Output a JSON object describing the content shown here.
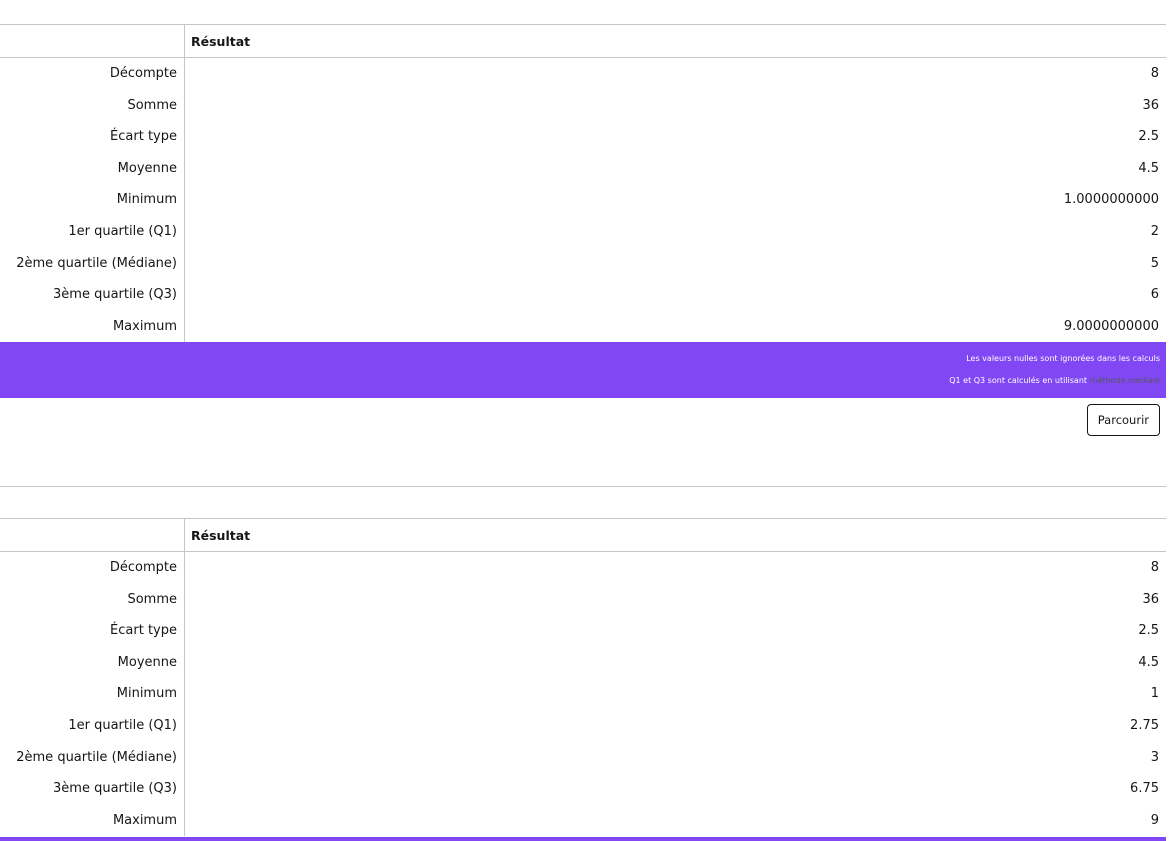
{
  "tables": [
    {
      "header": "Résultat",
      "rows": [
        {
          "label": "Décompte",
          "value": "8"
        },
        {
          "label": "Somme",
          "value": "36"
        },
        {
          "label": "Écart type",
          "value": "2.5"
        },
        {
          "label": "Moyenne",
          "value": "4.5"
        },
        {
          "label": "Minimum",
          "value": "1.0000000000"
        },
        {
          "label": "1er quartile (Q1)",
          "value": "2"
        },
        {
          "label": "2ème quartile (Médiane)",
          "value": "5"
        },
        {
          "label": "3ème quartile (Q3)",
          "value": "6"
        },
        {
          "label": "Maximum",
          "value": "9.0000000000"
        }
      ],
      "footer": {
        "note_nulls": "Les valeurs nulles sont ignorées dans les calculs",
        "note_quartiles_prefix": "Q1 et Q3 sont calculés en utilisant",
        "note_quartiles_link": "méthode médiale"
      },
      "browse_label": "Parcourir"
    },
    {
      "header": "Résultat",
      "rows": [
        {
          "label": "Décompte",
          "value": "8"
        },
        {
          "label": "Somme",
          "value": "36"
        },
        {
          "label": "Écart type",
          "value": "2.5"
        },
        {
          "label": "Moyenne",
          "value": "4.5"
        },
        {
          "label": "Minimum",
          "value": "1"
        },
        {
          "label": "1er quartile (Q1)",
          "value": "2.75"
        },
        {
          "label": "2ème quartile (Médiane)",
          "value": "3"
        },
        {
          "label": "3ème quartile (Q3)",
          "value": "6.75"
        },
        {
          "label": "Maximum",
          "value": "9"
        }
      ]
    }
  ],
  "colors": {
    "accent": "#8247f5",
    "border": "#c6c6c6",
    "text": "#161616"
  }
}
